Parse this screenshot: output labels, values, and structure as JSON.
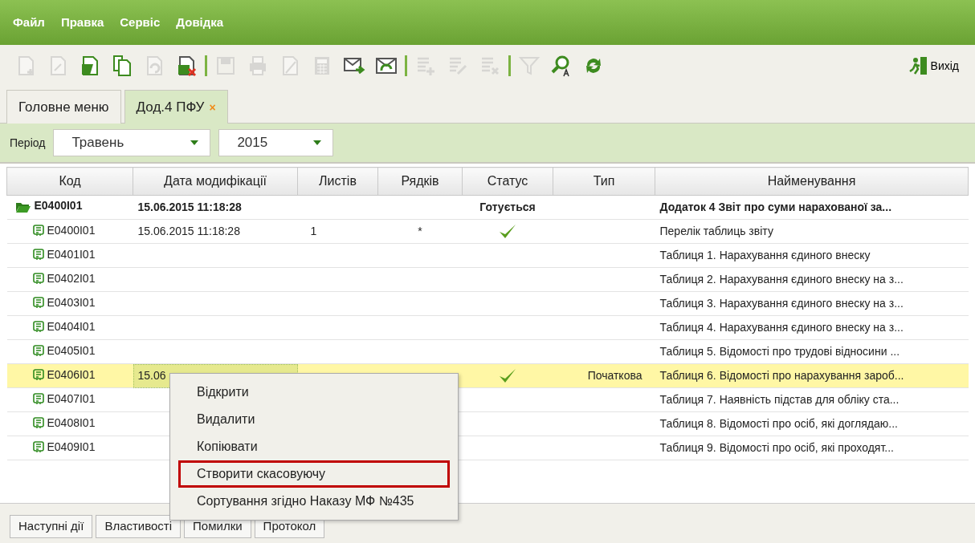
{
  "menu": [
    {
      "label": "Файл"
    },
    {
      "label": "Правка"
    },
    {
      "label": "Сервіс"
    },
    {
      "label": "Довідка"
    }
  ],
  "toolbar": {
    "buttons": [
      {
        "kind": "doc-add",
        "disabled": true
      },
      {
        "kind": "doc-edit",
        "disabled": true
      },
      {
        "kind": "doc-open",
        "disabled": false
      },
      {
        "kind": "doc-copy",
        "disabled": false
      },
      {
        "kind": "doc-undo",
        "disabled": true
      },
      {
        "kind": "doc-delete",
        "disabled": false
      },
      {
        "kind": "separator"
      },
      {
        "kind": "save",
        "disabled": true
      },
      {
        "kind": "print",
        "disabled": true
      },
      {
        "kind": "sign",
        "disabled": true
      },
      {
        "kind": "calculator",
        "disabled": true
      },
      {
        "kind": "mail-send",
        "disabled": false
      },
      {
        "kind": "mail-receive",
        "disabled": false
      },
      {
        "kind": "separator"
      },
      {
        "kind": "list-add",
        "disabled": true
      },
      {
        "kind": "list-edit",
        "disabled": true
      },
      {
        "kind": "list-delete",
        "disabled": true
      },
      {
        "kind": "separator"
      },
      {
        "kind": "filter",
        "disabled": true
      },
      {
        "kind": "search",
        "disabled": false
      },
      {
        "kind": "refresh",
        "disabled": false
      }
    ],
    "exit_label": "Вихід"
  },
  "tabs": [
    {
      "label": "Головне меню",
      "selected": false
    },
    {
      "label": "Дод.4 ПФУ",
      "selected": true,
      "close": "×"
    }
  ],
  "period": {
    "label": "Період",
    "month": "Травень",
    "year": "2015"
  },
  "table": {
    "columns": [
      "Код",
      "Дата модифікації",
      "Листів",
      "Рядків",
      "Статус",
      "Тип",
      "Найменування"
    ],
    "rows": [
      {
        "kind": "group",
        "expanded": true,
        "code": "E0400I01",
        "date": "15.06.2015 11:18:28",
        "sheets": "",
        "lines": "",
        "status": "Готується",
        "done": false,
        "type": "",
        "name": "Додаток 4 Звіт про суми нарахованої за...",
        "selected": false
      },
      {
        "kind": "item",
        "code": "E0400I01",
        "date": "15.06.2015 11:18:28",
        "sheets": "1",
        "lines": "*",
        "status": "",
        "done": true,
        "type": "",
        "name": "Перелік таблиць звіту",
        "selected": false
      },
      {
        "kind": "item",
        "code": "E0401I01",
        "date": "",
        "sheets": "",
        "lines": "",
        "status": "",
        "done": false,
        "type": "",
        "name": "Таблиця 1. Нарахування єдиного внеску",
        "selected": false
      },
      {
        "kind": "item",
        "code": "E0402I01",
        "date": "",
        "sheets": "",
        "lines": "",
        "status": "",
        "done": false,
        "type": "",
        "name": "Таблиця 2. Нарахування єдиного внеску на з...",
        "selected": false
      },
      {
        "kind": "item",
        "code": "E0403I01",
        "date": "",
        "sheets": "",
        "lines": "",
        "status": "",
        "done": false,
        "type": "",
        "name": "Таблиця 3. Нарахування єдиного внеску на з...",
        "selected": false
      },
      {
        "kind": "item",
        "code": "E0404I01",
        "date": "",
        "sheets": "",
        "lines": "",
        "status": "",
        "done": false,
        "type": "",
        "name": "Таблиця 4. Нарахування єдиного внеску на з...",
        "selected": false
      },
      {
        "kind": "item",
        "code": "E0405I01",
        "date": "",
        "sheets": "",
        "lines": "",
        "status": "",
        "done": false,
        "type": "",
        "name": "Таблиця 5. Відомості про трудові відносини ...",
        "selected": false
      },
      {
        "kind": "item",
        "code": "E0406I01",
        "date": "15.06",
        "sheets": "",
        "lines": "",
        "status": "",
        "done": true,
        "type": "Початкова",
        "name": "Таблиця 6. Відомості про нарахування зароб...",
        "selected": true
      },
      {
        "kind": "item",
        "code": "E0407I01",
        "date": "",
        "sheets": "",
        "lines": "",
        "status": "",
        "done": false,
        "type": "",
        "name": "Таблиця 7. Наявність підстав для обліку ста...",
        "selected": false
      },
      {
        "kind": "item",
        "code": "E0408I01",
        "date": "",
        "sheets": "",
        "lines": "",
        "status": "",
        "done": false,
        "type": "",
        "name": "Таблиця 8. Відомості про осіб, які доглядаю...",
        "selected": false
      },
      {
        "kind": "item",
        "code": "E0409I01",
        "date": "",
        "sheets": "",
        "lines": "",
        "status": "",
        "done": false,
        "type": "",
        "name": "Таблиця 9. Відомості про осіб, які проходят...",
        "selected": false
      }
    ]
  },
  "context_menu": {
    "items": [
      {
        "label": "Відкрити",
        "highlighted": false
      },
      {
        "label": "Видалити",
        "highlighted": false
      },
      {
        "label": "Копіювати",
        "highlighted": false
      },
      {
        "label": "Створити скасовуючу",
        "highlighted": true
      },
      {
        "label": "Сортування згідно Наказу МФ №435",
        "highlighted": false
      }
    ]
  },
  "bottom_tabs": [
    {
      "label": "Наступні дії"
    },
    {
      "label": "Властивості"
    },
    {
      "label": "Помилки"
    },
    {
      "label": "Протокол"
    }
  ]
}
